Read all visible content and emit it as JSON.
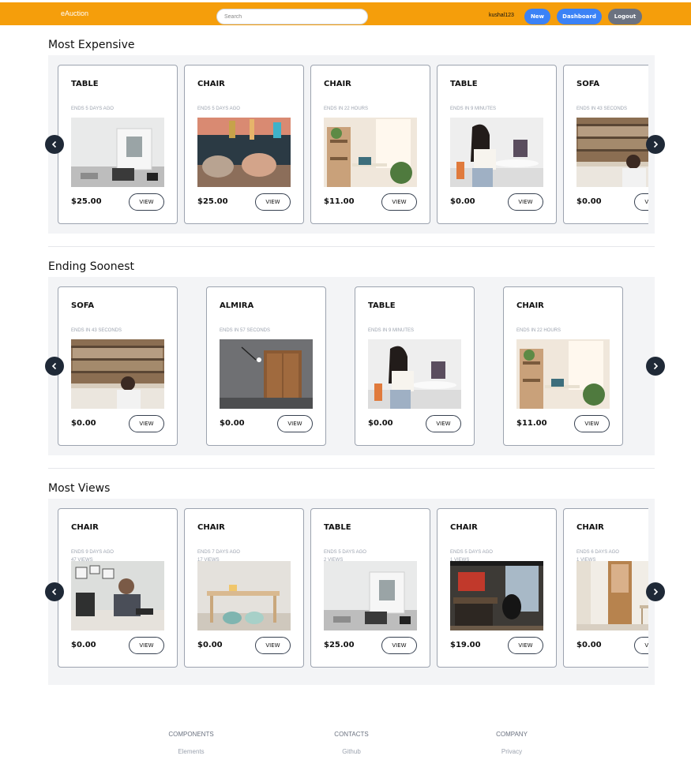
{
  "navbar": {
    "brand": "eAuction",
    "search_placeholder": "Search",
    "username": "kushal123",
    "new_label": "New",
    "dashboard_label": "Dashboard",
    "logout_label": "Logout",
    "color": "#f59e0b"
  },
  "sections": [
    {
      "title": "Most Expensive",
      "cards": [
        {
          "name": "TABLE",
          "ends": "ENDS 5 DAYS AGO",
          "views": "",
          "price": "$25.00",
          "button": "VIEW",
          "image": "desk-with-frame"
        },
        {
          "name": "CHAIR",
          "ends": "ENDS 5 DAYS AGO",
          "views": "",
          "price": "$25.00",
          "button": "VIEW",
          "image": "lounge-chairs"
        },
        {
          "name": "CHAIR",
          "ends": "ENDS IN 22 HOURS",
          "views": "",
          "price": "$11.00",
          "button": "VIEW",
          "image": "home-office-window"
        },
        {
          "name": "TABLE",
          "ends": "ENDS IN 9 MINUTES",
          "views": "",
          "price": "$0.00",
          "button": "VIEW",
          "image": "woman-at-laptop"
        },
        {
          "name": "SOFA",
          "ends": "ENDS IN 43 SECONDS",
          "views": "",
          "price": "$0.00",
          "button": "VIEW",
          "image": "library-man"
        }
      ]
    },
    {
      "title": "Ending Soonest",
      "cards": [
        {
          "name": "SOFA",
          "ends": "ENDS IN 43 SECONDS",
          "views": "",
          "price": "$0.00",
          "button": "VIEW",
          "image": "library-man"
        },
        {
          "name": "ALMIRA",
          "ends": "ENDS IN 57 SECONDS",
          "views": "",
          "price": "$0.00",
          "button": "VIEW",
          "image": "wood-cabinet"
        },
        {
          "name": "TABLE",
          "ends": "ENDS IN 9 MINUTES",
          "views": "",
          "price": "$0.00",
          "button": "VIEW",
          "image": "woman-at-laptop"
        },
        {
          "name": "CHAIR",
          "ends": "ENDS IN 22 HOURS",
          "views": "",
          "price": "$11.00",
          "button": "VIEW",
          "image": "home-office-window"
        }
      ]
    },
    {
      "title": "Most Views",
      "cards": [
        {
          "name": "CHAIR",
          "ends": "ENDS 9 DAYS AGO",
          "views": "47 VIEWS",
          "price": "$0.00",
          "button": "VIEW",
          "image": "man-on-phone"
        },
        {
          "name": "CHAIR",
          "ends": "ENDS 7 DAYS AGO",
          "views": "17 VIEWS",
          "price": "$0.00",
          "button": "VIEW",
          "image": "kids-table"
        },
        {
          "name": "TABLE",
          "ends": "ENDS 5 DAYS AGO",
          "views": "2 VIEWS",
          "price": "$25.00",
          "button": "VIEW",
          "image": "desk-with-frame"
        },
        {
          "name": "CHAIR",
          "ends": "ENDS 5 DAYS AGO",
          "views": "1 VIEWS",
          "price": "$19.00",
          "button": "VIEW",
          "image": "office-chair-window"
        },
        {
          "name": "CHAIR",
          "ends": "ENDS 6 DAYS AGO",
          "views": "1 VIEWS",
          "price": "$0.00",
          "button": "VIEW",
          "image": "wooden-chair-door"
        }
      ]
    }
  ],
  "footer": [
    {
      "heading": "COMPONENTS",
      "link": "Elements"
    },
    {
      "heading": "CONTACTS",
      "link": "Github"
    },
    {
      "heading": "COMPANY",
      "link": "Privacy"
    }
  ]
}
